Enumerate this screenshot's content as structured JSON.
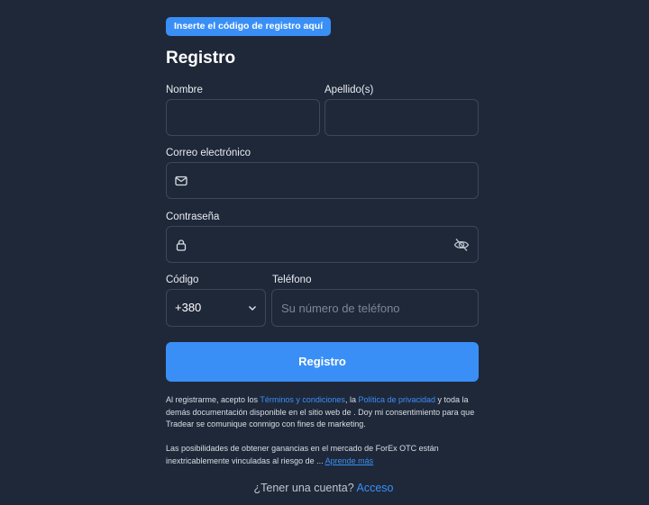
{
  "promo": {
    "label": "Inserte el código de registro aquí"
  },
  "form": {
    "title": "Registro",
    "first_name": {
      "label": "Nombre",
      "value": ""
    },
    "last_name": {
      "label": "Apellido(s)",
      "value": ""
    },
    "email": {
      "label": "Correo electrónico",
      "value": "",
      "icon": "mail-icon"
    },
    "password": {
      "label": "Contraseña",
      "value": "",
      "icon": "lock-icon",
      "toggle_icon": "eye-off-icon"
    },
    "code": {
      "label": "Código",
      "value": "+380"
    },
    "phone": {
      "label": "Teléfono",
      "placeholder": "Su número de teléfono"
    },
    "submit_label": "Registro"
  },
  "legal": {
    "p1_a": "Al registrarme, acepto los ",
    "terms_link": "Términos y condiciones",
    "p1_b": ", la ",
    "privacy_link": "Política de privacidad",
    "p1_c": " y toda la demás documentación disponible en el sitio web de . Doy mi consentimiento para que Tradear se comunique conmigo con fines de marketing.",
    "p2": "Las posibilidades de obtener ganancias en el mercado de ForEx OTC están inextricablemente vinculadas al riesgo de ... ",
    "learn_more_link": "Aprende más"
  },
  "footer": {
    "question": "¿Tener una cuenta? ",
    "login_link": "Acceso"
  },
  "colors": {
    "background": "#1f2839",
    "accent": "#3a8ff6",
    "border": "#3b475b"
  }
}
